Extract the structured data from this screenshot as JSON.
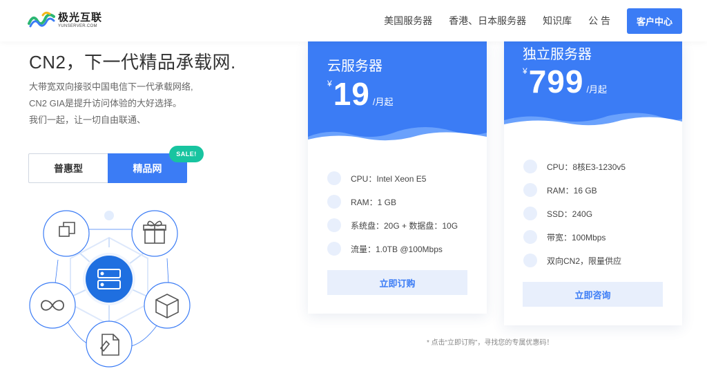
{
  "logo": {
    "name": "极光互联",
    "sub": "YUNSERVER.COM"
  },
  "nav": {
    "items": [
      "美国服务器",
      "香港、日本服务器",
      "知识库",
      "公 告"
    ],
    "cta": "客户中心"
  },
  "hero": {
    "title": "CN2，下一代精品承载网.",
    "desc": [
      "大带宽双向接驳中国电信下一代承载网络,",
      "CN2 GIA是提升访问体验的大好选择。",
      "我们一起，让一切自由联通、"
    ]
  },
  "tabs": {
    "normal": "普惠型",
    "active": "精品网",
    "badge": "SALE!"
  },
  "cards": [
    {
      "title": "云服务器",
      "yen": "¥",
      "price": "19",
      "per": "/月起",
      "specs": [
        "CPU：Intel Xeon E5",
        "RAM：1 GB",
        "系统盘：20G + 数据盘：10G",
        "流量：1.0TB @100Mbps"
      ],
      "button": "立即订购"
    },
    {
      "title": "独立服务器",
      "yen": "¥",
      "price": "799",
      "per": "/月起",
      "specs": [
        "CPU：8核E3-1230v5",
        "RAM：16 GB",
        "SSD：240G",
        "带宽：100Mbps",
        "双向CN2，限量供应"
      ],
      "button": "立即咨询"
    }
  ],
  "footnote": "* 点击“立即订购”，寻找您的专属优惠码！",
  "colors": {
    "primary": "#3b7cf5",
    "badge": "#18c4a0",
    "light": "#e8effc"
  },
  "diagram": {
    "icons": [
      "window-stack-icon",
      "gift-icon",
      "infinity-icon",
      "box-icon",
      "document-pen-icon",
      "server-icon"
    ]
  }
}
